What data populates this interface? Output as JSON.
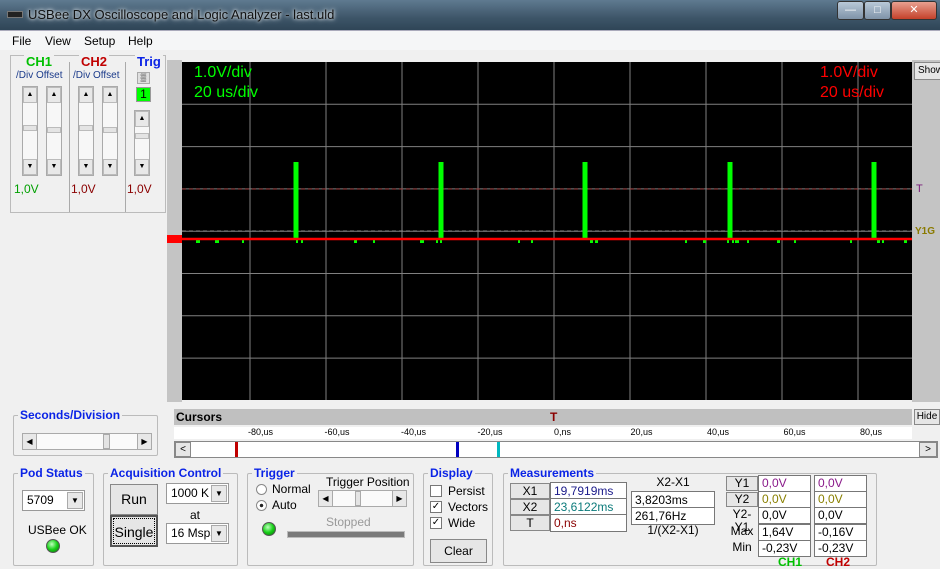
{
  "window": {
    "title": "USBee DX Oscilloscope and Logic Analyzer - last.uld",
    "controls": [
      "minimize",
      "maximize",
      "close"
    ]
  },
  "menu": [
    "File",
    "View",
    "Setup",
    "Help"
  ],
  "channels": {
    "ch1": {
      "label": "CH1",
      "div_label": "/Div",
      "offset_label": "Offset",
      "value": "1,0V",
      "color": "#00c000"
    },
    "ch2": {
      "label": "CH2",
      "div_label": "/Div",
      "offset_label": "Offset",
      "value": "1,0V",
      "color": "#c00000"
    },
    "trig": {
      "label": "Trig",
      "channel": "1",
      "value": "1,0V",
      "color": "#0a23e6"
    }
  },
  "scope": {
    "ch1_vdiv": "1.0V/div",
    "ch1_tdiv": "20 us/div",
    "ch2_vdiv": "1.0V/div",
    "ch2_tdiv": "20 us/div",
    "marker_t": "T",
    "marker_y": "Y1G",
    "show_label": "Show",
    "hide_label": "Hide",
    "ch1_color": "#00ff00",
    "ch2_color": "#ff0000"
  },
  "seconds_division": {
    "label": "Seconds/Division",
    "position": 0.67
  },
  "cursors": {
    "label": "Cursors",
    "trigger_marker": "T",
    "ticks": [
      "-80,us",
      "-60,us",
      "-40,us",
      "-20,us",
      "0,ns",
      "20,us",
      "40,us",
      "60,us",
      "80,us"
    ],
    "left": "<",
    "right": ">"
  },
  "pod_status": {
    "label": "Pod Status",
    "pod": "5709",
    "status": "USBee OK"
  },
  "acquisition": {
    "label": "Acquisition Control",
    "run": "Run",
    "single": "Single",
    "samples": "1000 K",
    "at": "at",
    "rate": "16 Msps"
  },
  "trigger": {
    "label": "Trigger",
    "normal": "Normal",
    "auto": "Auto",
    "selected": "Auto",
    "position_label": "Trigger Position",
    "status": "Stopped",
    "position": 0.35
  },
  "display": {
    "label": "Display",
    "persist": {
      "label": "Persist",
      "checked": false
    },
    "vectors": {
      "label": "Vectors",
      "checked": true
    },
    "wide": {
      "label": "Wide",
      "checked": true
    },
    "clear": "Clear"
  },
  "measurements": {
    "label": "Measurements",
    "x1_label": "X1",
    "x1": "19,7919ms",
    "x2_label": "X2",
    "x2": "23,6122ms",
    "t_label": "T",
    "t": "0,ns",
    "diff_label": "X2-X1",
    "diff": "3,8203ms",
    "freq": "261,76Hz",
    "freq_label": "1/(X2-X1)",
    "rows": [
      {
        "label": "Y1",
        "ch1": "0,0V",
        "ch2": "0,0V"
      },
      {
        "label": "Y2",
        "ch1": "0,0V",
        "ch2": "0,0V"
      },
      {
        "label": "Y2-Y1",
        "ch1": "0,0V",
        "ch2": "0,0V"
      },
      {
        "label": "Max",
        "ch1": "1,64V",
        "ch2": "-0,16V"
      },
      {
        "label": "Min",
        "ch1": "-0,23V",
        "ch2": "-0,23V"
      }
    ],
    "ch1_label": "CH1",
    "ch2_label": "CH2"
  }
}
